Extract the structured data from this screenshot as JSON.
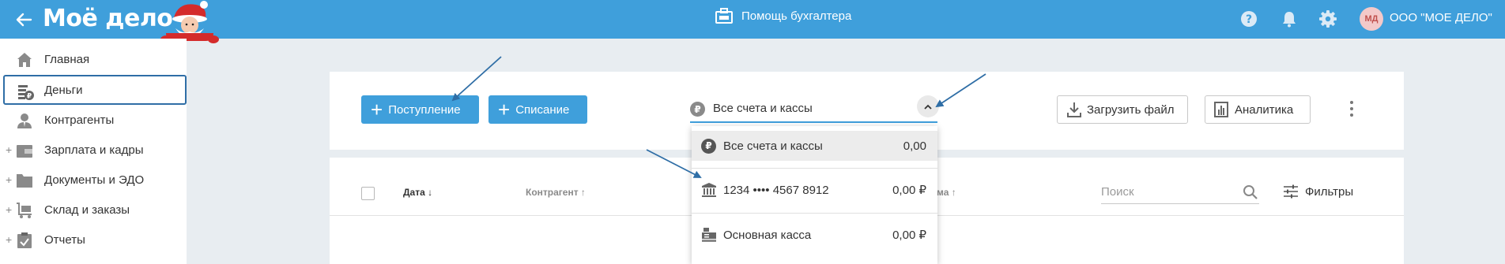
{
  "header": {
    "logo": "Моё дело",
    "center_title": "Помощь бухгалтера",
    "avatar_initials": "МД",
    "org_name": "ООО \"МОЕ ДЕЛО\"",
    "icons": [
      "back-arrow-icon",
      "briefcase-icon",
      "help-icon",
      "bell-icon",
      "gear-icon"
    ],
    "color": "#3f9fdb"
  },
  "sidebar": {
    "items": [
      {
        "label": "Главная",
        "icon": "home-icon"
      },
      {
        "label": "Деньги",
        "icon": "money-icon",
        "active": true
      },
      {
        "label": "Контрагенты",
        "icon": "person-icon"
      },
      {
        "label": "Зарплата и кадры",
        "icon": "wallet-icon",
        "expandable": true
      },
      {
        "label": "Документы и ЭДО",
        "icon": "folder-icon",
        "expandable": true
      },
      {
        "label": "Склад и заказы",
        "icon": "cart-icon",
        "expandable": true
      },
      {
        "label": "Отчеты",
        "icon": "report-icon",
        "expandable": true
      }
    ],
    "expand_symbol": "+"
  },
  "toolbar": {
    "income_label": "Поступление",
    "expense_label": "Списание",
    "account_select_value": "Все счета и кассы",
    "ruble_symbol": "₽",
    "upload_label": "Загрузить файл",
    "analytics_label": "Аналитика"
  },
  "table": {
    "col_date": "Дата ↓",
    "col_counterparty": "Контрагент ↑",
    "col_sum": "ма ↑",
    "search_placeholder": "Поиск",
    "filters_label": "Фильтры"
  },
  "dropdown": {
    "items": [
      {
        "label": "Все счета и кассы",
        "value": "0,00",
        "icon": "ruble-icon",
        "selected": true
      },
      {
        "label": "1234 •••• 4567 8912",
        "value": "0,00 ₽",
        "icon": "bank-icon"
      },
      {
        "label": "Основная касса",
        "value": "0,00 ₽",
        "icon": "cash-register-icon"
      }
    ]
  }
}
